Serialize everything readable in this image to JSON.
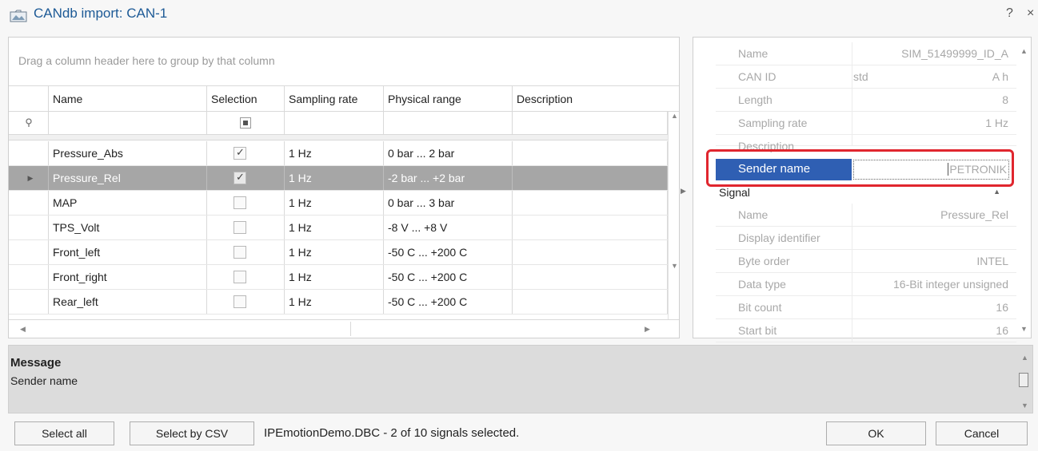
{
  "window": {
    "title": "CANdb import: CAN-1",
    "help_label": "?",
    "close_label": "×"
  },
  "grid": {
    "group_hint": "Drag a column header here to group by that column",
    "columns": [
      "Name",
      "Selection",
      "Sampling rate",
      "Physical range",
      "Description"
    ],
    "rows": [
      {
        "name": "Pressure_Abs",
        "selected": true,
        "rate": "1 Hz",
        "range": "0 bar ... 2 bar",
        "description": ""
      },
      {
        "name": "Pressure_Rel",
        "selected": true,
        "rate": "1 Hz",
        "range": "-2 bar ... +2 bar",
        "description": "",
        "current": true
      },
      {
        "name": "MAP",
        "selected": false,
        "rate": "1 Hz",
        "range": "0 bar ... 3 bar",
        "description": ""
      },
      {
        "name": "TPS_Volt",
        "selected": false,
        "rate": "1 Hz",
        "range": "-8 V ... +8 V",
        "description": ""
      },
      {
        "name": "Front_left",
        "selected": false,
        "rate": "1 Hz",
        "range": "-50 C ... +200 C",
        "description": ""
      },
      {
        "name": "Front_right",
        "selected": false,
        "rate": "1 Hz",
        "range": "-50 C ... +200 C",
        "description": ""
      },
      {
        "name": "Rear_left",
        "selected": false,
        "rate": "1 Hz",
        "range": "-50 C ... +200 C",
        "description": ""
      }
    ]
  },
  "properties": {
    "message_props": [
      {
        "name": "Name",
        "value": "SIM_51499999_ID_A"
      },
      {
        "name": "CAN ID",
        "value_left": "std",
        "value": "A h"
      },
      {
        "name": "Length",
        "value": "8"
      },
      {
        "name": "Sampling rate",
        "value": "1 Hz"
      },
      {
        "name": "Description",
        "value": ""
      }
    ],
    "sender": {
      "name": "Sender name",
      "value": "PETRONIK"
    },
    "signal_category": "Signal",
    "signal_props": [
      {
        "name": "Name",
        "value": "Pressure_Rel"
      },
      {
        "name": "Display identifier",
        "value": ""
      },
      {
        "name": "Byte order",
        "value": "INTEL"
      },
      {
        "name": "Data type",
        "value": "16-Bit integer unsigned"
      },
      {
        "name": "Bit count",
        "value": "16"
      },
      {
        "name": "Start bit",
        "value": "16"
      }
    ]
  },
  "message_box": {
    "title": "Message",
    "body": "Sender name"
  },
  "footer": {
    "select_all": "Select all",
    "select_csv": "Select by CSV",
    "status": "IPEmotionDemo.DBC  -  2 of 10 signals selected.",
    "ok": "OK",
    "cancel": "Cancel"
  },
  "colors": {
    "title": "#1d5a96",
    "selected_row": "#a6a6a6",
    "sender_highlight": "#2f5fb3",
    "annotation_box": "#e0262e"
  }
}
